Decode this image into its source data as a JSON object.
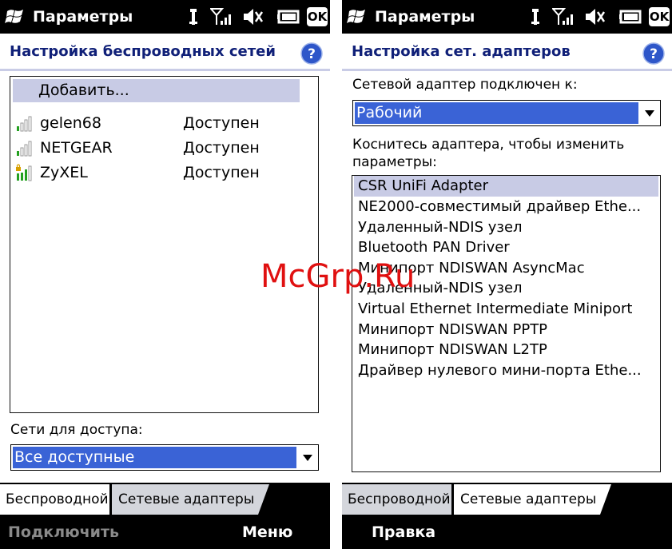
{
  "left": {
    "app_title": "Параметры",
    "header_title": "Настройка беспроводных сетей",
    "add_label": "Добавить...",
    "networks": [
      {
        "name": "gelen68",
        "status": "Доступен",
        "signal_icon": "signal-bars-weak-icon"
      },
      {
        "name": "NETGEAR",
        "status": "Доступен",
        "signal_icon": "signal-bars-weak-icon"
      },
      {
        "name": "ZyXEL",
        "status": "Доступен",
        "signal_icon": "signal-bars-locked-strong-icon"
      }
    ],
    "filter_label": "Сети для доступа:",
    "filter_value": "Все доступные",
    "tabs": [
      "Беспроводной",
      "Сетевые адаптеры"
    ],
    "softkey_left": "Подключить",
    "softkey_right": "Меню"
  },
  "right": {
    "app_title": "Параметры",
    "header_title": "Настройка сет. адаптеров",
    "connected_label": "Сетевой адаптер подключен к:",
    "connected_value": "Рабочий",
    "hint_line1": "Коснитесь адаптера, чтобы изменить",
    "hint_line2": "параметры:",
    "adapters": [
      "CSR UniFi Adapter",
      "NE2000-совместимый драйвер Ethe...",
      "Удаленный-NDIS узел",
      "Bluetooth PAN Driver",
      "Минипорт NDISWAN AsyncMac",
      "Удаленный-NDIS узел",
      "Virtual Ethernet Intermediate Miniport",
      "Минипорт NDISWAN PPTP",
      "Минипорт NDISWAN L2TP",
      "Драйвер нулевого мини-порта Ethe..."
    ],
    "tabs": [
      "Беспроводной",
      "Сетевые адаптеры"
    ],
    "softkey_left": "Правка"
  },
  "status_icons": [
    "antenna-icon",
    "signal-strength-icon",
    "speaker-mute-icon",
    "battery-icon",
    "ok-button"
  ],
  "ok_label": "OK",
  "help_glyph": "?",
  "watermark": "McGrp.Ru",
  "colors": {
    "header_text": "#102078",
    "selection": "#3a63d6",
    "highlight_row": "#c8cbe5",
    "tab_inactive": "#d4d6dc",
    "softkey_disabled": "#8a8a8a",
    "softkey_enabled": "#ffffff",
    "watermark": "#e01010"
  }
}
